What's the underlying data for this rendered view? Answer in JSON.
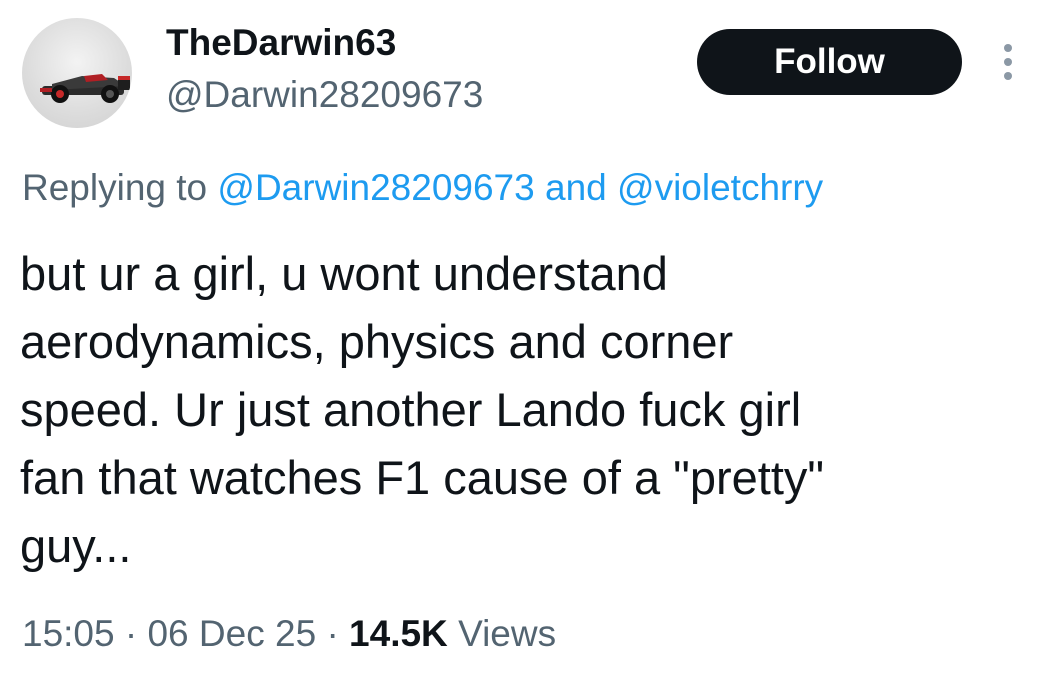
{
  "user": {
    "display_name": "TheDarwin63",
    "handle": "@Darwin28209673",
    "avatar_icon": "f1-car-avatar"
  },
  "actions": {
    "follow_label": "Follow",
    "more_icon": "more-vertical-icon"
  },
  "reply": {
    "prefix": "Replying to",
    "mention_1": "@Darwin28209673",
    "conjunction": "and",
    "mention_2": "@violetchrry"
  },
  "tweet": {
    "lines": [
      "but ur a girl, u wont understand",
      "aerodynamics, physics and corner",
      "speed. Ur just another Lando fuck girl",
      "fan that watches F1 cause of a \"pretty\"",
      "guy..."
    ]
  },
  "meta": {
    "time": "15:05",
    "separator": "·",
    "date": "06 Dec 25",
    "views_count": "14.5K",
    "views_label": "Views"
  },
  "colors": {
    "accent": "#1d9bf0",
    "secondary_text": "#536471",
    "primary_text": "#0f1419",
    "button_bg": "#0f1419"
  }
}
